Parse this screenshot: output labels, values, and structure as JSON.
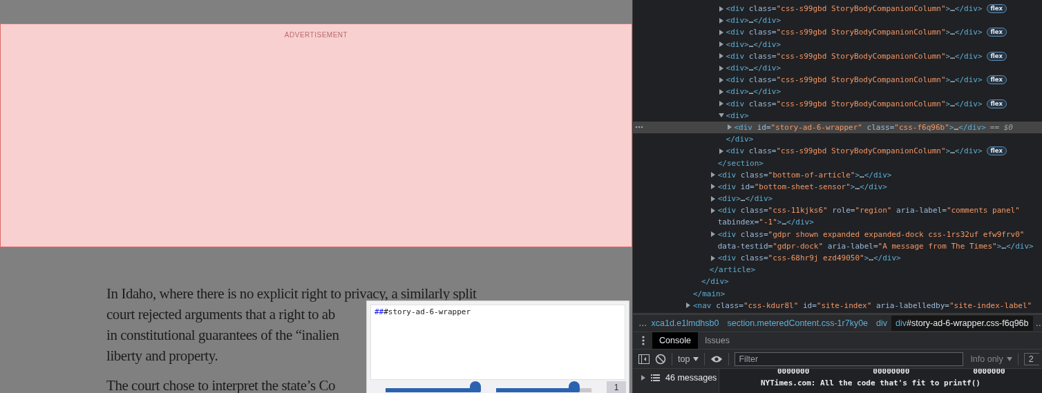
{
  "page": {
    "ad_label": "ADVERTISEMENT",
    "paragraphs": [
      [
        "In Idaho, where there is no explicit right to privacy, a similarly split",
        "court rejected arguments that a right to ab",
        "in constitutional guarantees of the “inalien",
        "liberty and property."
      ],
      [
        "The court chose to interpret the state’s Co"
      ]
    ]
  },
  "inspect_popup": {
    "prefix": "##",
    "selector": "#story-ad-6-wrapper",
    "sliders": [
      {
        "level": 1.0
      },
      {
        "level": 0.82
      }
    ],
    "counter": "1"
  },
  "devtools": {
    "tree": [
      {
        "selected": false,
        "children": [
          {
            "selected": false,
            "children": [
              {
                "selected": false,
                "children": [
                  {
                    "selected": false,
                    "children": [
                      {
                        "lines": [
                          "<div class=\"css-s99gbd StoryBodyCompanionColumn\">…</div>"
                        ],
                        "expanded": false,
                        "badge": "flex",
                        "selected": false
                      },
                      {
                        "lines": [
                          "<div>…</div>"
                        ],
                        "expanded": false,
                        "selected": false
                      },
                      {
                        "lines": [
                          "<div class=\"css-s99gbd StoryBodyCompanionColumn\">…</div>"
                        ],
                        "expanded": false,
                        "badge": "flex",
                        "selected": false
                      },
                      {
                        "lines": [
                          "<div>…</div>"
                        ],
                        "expanded": false,
                        "selected": false
                      },
                      {
                        "lines": [
                          "<div class=\"css-s99gbd StoryBodyCompanionColumn\">…</div>"
                        ],
                        "expanded": false,
                        "badge": "flex",
                        "selected": false
                      },
                      {
                        "lines": [
                          "<div>…</div>"
                        ],
                        "expanded": false,
                        "selected": false
                      },
                      {
                        "lines": [
                          "<div class=\"css-s99gbd StoryBodyCompanionColumn\">…</div>"
                        ],
                        "expanded": false,
                        "badge": "flex",
                        "selected": false
                      },
                      {
                        "lines": [
                          "<div>…</div>"
                        ],
                        "expanded": false,
                        "selected": false
                      },
                      {
                        "lines": [
                          "<div class=\"css-s99gbd StoryBodyCompanionColumn\">…</div>"
                        ],
                        "expanded": false,
                        "badge": "flex",
                        "selected": false
                      },
                      {
                        "lines": [
                          "<div>"
                        ],
                        "expanded": true,
                        "selected": false,
                        "children": [
                          {
                            "lines": [
                              "<div id=\"story-ad-6-wrapper\" class=\"css-f6q96b\">…</div>"
                            ],
                            "expanded": false,
                            "selected": true,
                            "ref": "== $0"
                          }
                        ],
                        "close": "</div>"
                      },
                      {
                        "lines": [
                          "<div class=\"css-s99gbd StoryBodyCompanionColumn\">…</div>"
                        ],
                        "expanded": false,
                        "badge": "flex",
                        "selected": false
                      }
                    ],
                    "close": "</section>"
                  },
                  {
                    "lines": [
                      "<div class=\"bottom-of-article\">…</div>"
                    ],
                    "expanded": false,
                    "selected": false
                  },
                  {
                    "lines": [
                      "<div id=\"bottom-sheet-sensor\">…</div>"
                    ],
                    "expanded": false,
                    "selected": false
                  },
                  {
                    "lines": [
                      "<div>…</div>"
                    ],
                    "expanded": false,
                    "selected": false
                  },
                  {
                    "lines": [
                      "<div class=\"css-11kjks6\" role=\"region\" aria-label=\"comments panel\"",
                      "tabindex=\"-1\">…</div>"
                    ],
                    "expanded": false,
                    "selected": false
                  },
                  {
                    "lines": [
                      "<div class=\"gdpr shown expanded expanded-dock css-1rs32uf efw9frv0\"",
                      "data-testid=\"gdpr-dock\" aria-label=\"A message from The Times\">…</div>"
                    ],
                    "expanded": false,
                    "selected": false
                  },
                  {
                    "lines": [
                      "<div class=\"css-68hr9j ezd49050\">…</div>"
                    ],
                    "expanded": false,
                    "selected": false
                  }
                ],
                "close": "</article>"
              }
            ],
            "close": "</div>"
          }
        ],
        "close": "</main>"
      },
      {
        "lines": [
          "<nav class=\"css-kdur8l\" id=\"site-index\" aria-labelledby=\"site-index-label\""
        ],
        "expanded": false,
        "selected": false
      }
    ],
    "breadcrumbs": {
      "lead": "…",
      "trail": "…",
      "items": [
        {
          "rest": "xca1d.e1lmdhsb0",
          "selected": false
        },
        {
          "tag": "section",
          "rest": ".meteredContent.css-1r7ky0e",
          "selected": false
        },
        {
          "tag": "div",
          "selected": false
        },
        {
          "tag": "div",
          "rest": "#story-ad-6-wrapper.css-f6q96b",
          "selected": true
        }
      ]
    },
    "tabs": [
      {
        "label": "Console",
        "selected": true
      },
      {
        "label": "Issues",
        "selected": false
      }
    ],
    "toolbar": {
      "context": "top",
      "filter_placeholder": "Filter",
      "levels": "Info only",
      "count": "2"
    },
    "sidebar": {
      "messages": "46 messages"
    },
    "output": {
      "art_row": [
        "0000000",
        "00000000",
        "0000000"
      ],
      "message": "NYTimes.com: All the code that's fit to printf()"
    }
  }
}
